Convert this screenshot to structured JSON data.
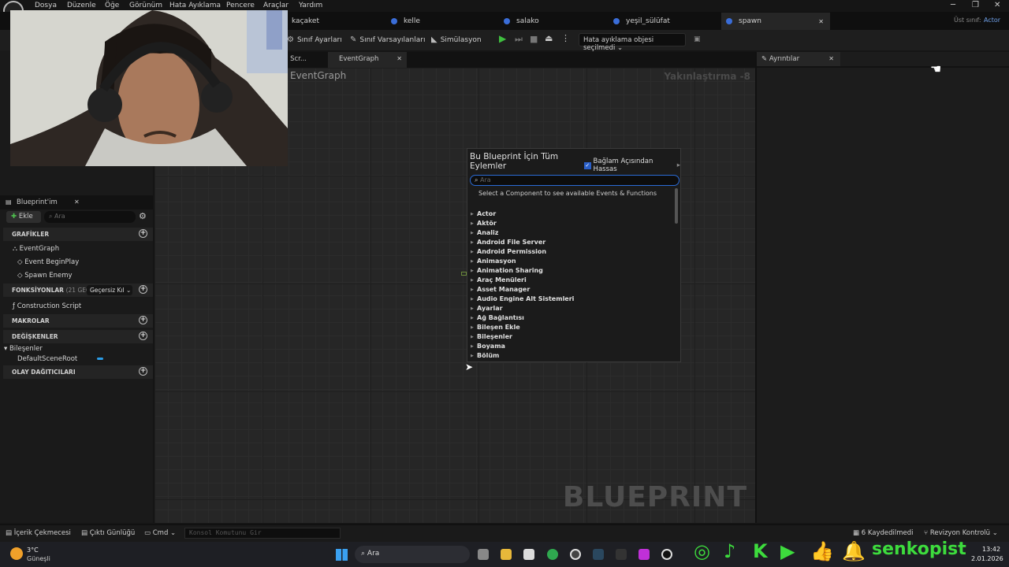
{
  "menubar": {
    "items": [
      "Dosya",
      "Düzenle",
      "Öğe",
      "Görünüm",
      "Hata Ayıklama",
      "Pencere",
      "Araçlar",
      "Yardım"
    ]
  },
  "tabs": [
    {
      "label": "kaçaket"
    },
    {
      "label": "kelle"
    },
    {
      "label": "salako"
    },
    {
      "label": "yeşil_sülüfat"
    },
    {
      "label": "spawn",
      "active": true
    }
  ],
  "parent_class": {
    "label": "Üst sınıf:",
    "value": "Actor"
  },
  "toolbar": {
    "class_settings": "Sınıf Ayarları",
    "class_defaults": "Sınıf Varsayılanları",
    "simulation": "Simülasyon",
    "debug_object": "Hata ayıklama objesi seçilmedi"
  },
  "graph_tabs": {
    "construction_partial": "n Scr...",
    "event_graph": "EventGraph"
  },
  "graph": {
    "breadcrumb": "EventGraph",
    "zoom": "Yakınlaştırma -8",
    "watermark": "BLUEPRINT"
  },
  "details": {
    "title": "Ayrıntılar"
  },
  "my_blueprint": {
    "title": "Blueprint'im",
    "add_label": "Ekle",
    "search_placeholder": "Ara",
    "sections": {
      "graphs": "GRAFİKLER",
      "functions": "FONKSİYONLAR",
      "functions_count": "(21 GEÇERSİ",
      "override_label": "Geçersiz Kıl",
      "macros": "MAKROLAR",
      "variables": "DEĞİŞKENLER",
      "dispatchers": "OLAY DAĞITICILARI"
    },
    "graph_items": [
      "EventGraph",
      "Event BeginPlay",
      "Spawn Enemy"
    ],
    "function_items": [
      "Construction Script"
    ],
    "components_label": "Bileşenler",
    "component_items": [
      "DefaultSceneRoot"
    ]
  },
  "popup": {
    "title": "Bu Blueprint İçin Tüm Eylemler",
    "context_label": "Bağlam Açısından Hassas",
    "search_placeholder": "Ara",
    "hint": "Select a Component to see available Events & Functions",
    "categories": [
      "Actor",
      "Aktör",
      "Analiz",
      "Android File Server",
      "Android Permission",
      "Animasyon",
      "Animation Sharing",
      "Araç Menüleri",
      "Asset Manager",
      "Audio Engine Alt Sistemleri",
      "Ayarlar",
      "Ağ Bağlantısı",
      "Bileşen Ekle",
      "Bileşenler",
      "Boyama",
      "Bölüm"
    ]
  },
  "statusbar": {
    "content_drawer": "İçerik Çekmecesi",
    "output_log": "Çıktı Günlüğü",
    "cmd": "Cmd",
    "console_placeholder": "Konsol Komutunu Gir",
    "saved": "6 Kaydedilmedi",
    "revision": "Revizyon Kontrolü"
  },
  "taskbar": {
    "weather_temp": "3°C",
    "weather_desc": "Güneşli",
    "search_label": "Ara",
    "time": "13:42",
    "date": "2.01.2026",
    "streamer": "senkopist"
  },
  "colors": {
    "accent_blue": "#3a6dd8",
    "play_green": "#3fbf3f",
    "social_green": "#3ddc3d"
  }
}
